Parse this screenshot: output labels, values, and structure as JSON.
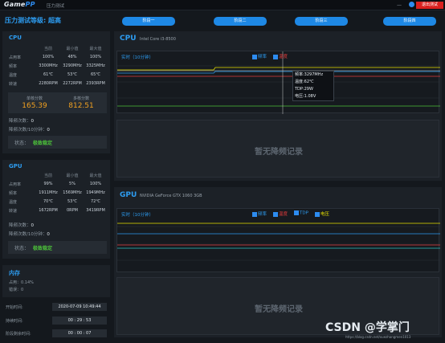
{
  "app": {
    "logo_main": "Game",
    "logo_accent": "PP",
    "window_title": "压力测试",
    "minimize": "—",
    "exit_label": "退出测试"
  },
  "level": {
    "label": "压力测试等级: 超高"
  },
  "stages": [
    "阶段一",
    "阶段二",
    "阶段三",
    "阶段四"
  ],
  "cpu_panel": {
    "title": "CPU",
    "headers": [
      "当前",
      "最小值",
      "最大值"
    ],
    "rows": [
      {
        "name": "占用率",
        "cur": "100%",
        "min": "48%",
        "max": "100%"
      },
      {
        "name": "频率",
        "cur": "3300MHz",
        "min": "3290MHz",
        "max": "3325MHz"
      },
      {
        "name": "温度",
        "cur": "61℃",
        "min": "53℃",
        "max": "65℃"
      },
      {
        "name": "转速",
        "cur": "2280RPM",
        "min": "2272RPM",
        "max": "2393RPM"
      }
    ],
    "score_single_label": "单核分数",
    "score_single": "165.39",
    "score_multi_label": "多核分数",
    "score_multi": "812.51",
    "throttle_count_label": "降频次数：",
    "throttle_count": "0",
    "throttle_rate_label": "降频次数/10分钟：",
    "throttle_rate": "0",
    "state_label": "状态：",
    "state_value": "极致稳定"
  },
  "gpu_panel": {
    "title": "GPU",
    "headers": [
      "当前",
      "最小值",
      "最大值"
    ],
    "rows": [
      {
        "name": "占用率",
        "cur": "99%",
        "min": "5%",
        "max": "100%"
      },
      {
        "name": "频率",
        "cur": "1911MHz",
        "min": "1569MHz",
        "max": "1949MHz"
      },
      {
        "name": "温度",
        "cur": "70℃",
        "min": "53℃",
        "max": "72℃"
      },
      {
        "name": "转速",
        "cur": "1672RPM",
        "min": "0RPM",
        "max": "3419RPM"
      }
    ],
    "throttle_count_label": "降频次数：",
    "throttle_count": "0",
    "throttle_rate_label": "降频次数/10分钟：",
    "throttle_rate": "0",
    "state_label": "状态：",
    "state_value": "极致稳定"
  },
  "memory_panel": {
    "title": "内存",
    "usage_label": "占用：",
    "usage": "0.14%",
    "error_label": "错误：",
    "error": "0"
  },
  "info": [
    {
      "label": "开始时间:",
      "value": "2020-07-09 10:49:44"
    },
    {
      "label": "持续时间:",
      "value": "00 : 29 : 53"
    },
    {
      "label": "阶段剩余时间:",
      "value": "00 : 00 : 07"
    }
  ],
  "cpu_chart": {
    "title": "CPU",
    "model": "Intel Core i3-8500",
    "realtime_label": "实时（10分钟）",
    "legend": [
      {
        "label": "频率",
        "color": "#2d9cf0"
      },
      {
        "label": "温度",
        "color": "#e23b3b"
      }
    ],
    "tooltip": [
      "频率:3297MHz",
      "温度:62℃",
      "TDP:29W",
      "电压:1.08V"
    ],
    "no_record": "暂无降频记录"
  },
  "gpu_chart": {
    "title": "GPU",
    "model": "NVIDIA GeForce GTX 1060 3GB",
    "realtime_label": "实时（10分钟）",
    "legend": [
      {
        "label": "频率",
        "color": "#2d9cf0"
      },
      {
        "label": "温度",
        "color": "#e23b3b"
      },
      {
        "label": "TDP",
        "color": "#2d9cf0"
      },
      {
        "label": "电压",
        "color": "#e8e000"
      }
    ],
    "no_record": "暂无降频记录"
  },
  "watermark": {
    "text": "CSDN @学掌门",
    "url": "https://blog.csdn.net/xuezhangmen1013"
  }
}
